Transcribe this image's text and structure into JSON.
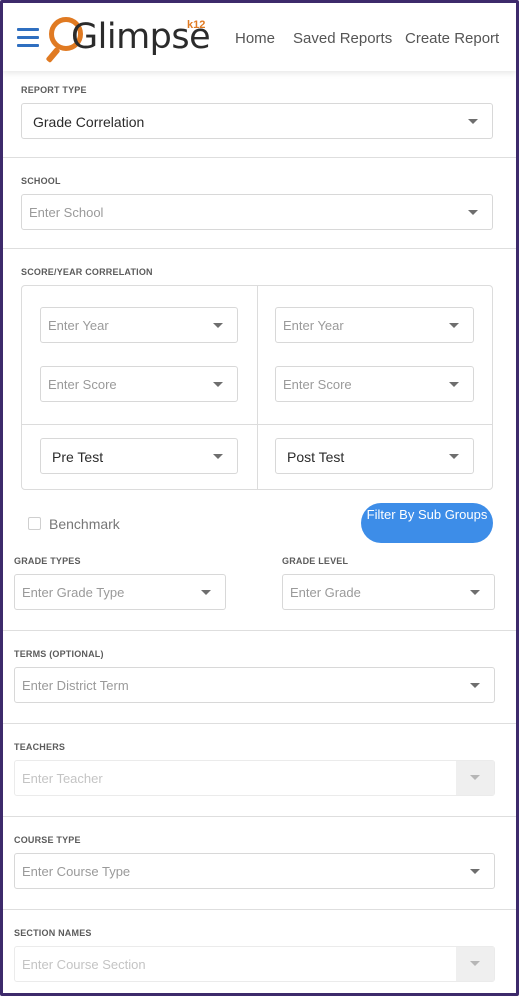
{
  "header": {
    "logo_text": "Glimpse",
    "logo_suffix": "k12",
    "nav": [
      "Home",
      "Saved Reports",
      "Create Report"
    ]
  },
  "report_type": {
    "label": "REPORT TYPE",
    "value": "Grade Correlation"
  },
  "school": {
    "label": "SCHOOL",
    "placeholder": "Enter School"
  },
  "score_year": {
    "label": "SCORE/YEAR CORRELATION",
    "left": {
      "year_placeholder": "Enter Year",
      "score_placeholder": "Enter Score",
      "test": "Pre Test"
    },
    "right": {
      "year_placeholder": "Enter Year",
      "score_placeholder": "Enter Score",
      "test": "Post Test"
    }
  },
  "benchmark_label": "Benchmark",
  "filter_button": "Filter By Sub Groups",
  "grade_types": {
    "label": "GRADE TYPES",
    "placeholder": "Enter Grade Type"
  },
  "grade_level": {
    "label": "GRADE LEVEL",
    "placeholder": "Enter Grade"
  },
  "terms": {
    "label": "TERMS (OPTIONAL)",
    "placeholder": "Enter District Term"
  },
  "teachers": {
    "label": "TEACHERS",
    "placeholder": "Enter Teacher"
  },
  "course_type": {
    "label": "COURSE TYPE",
    "placeholder": "Enter Course Type"
  },
  "section_names": {
    "label": "SECTION NAMES",
    "placeholder": "Enter Course Section"
  },
  "colors": {
    "accent": "#3d8de8",
    "brand_orange": "#e07a22",
    "frame": "#3d2a6b"
  }
}
